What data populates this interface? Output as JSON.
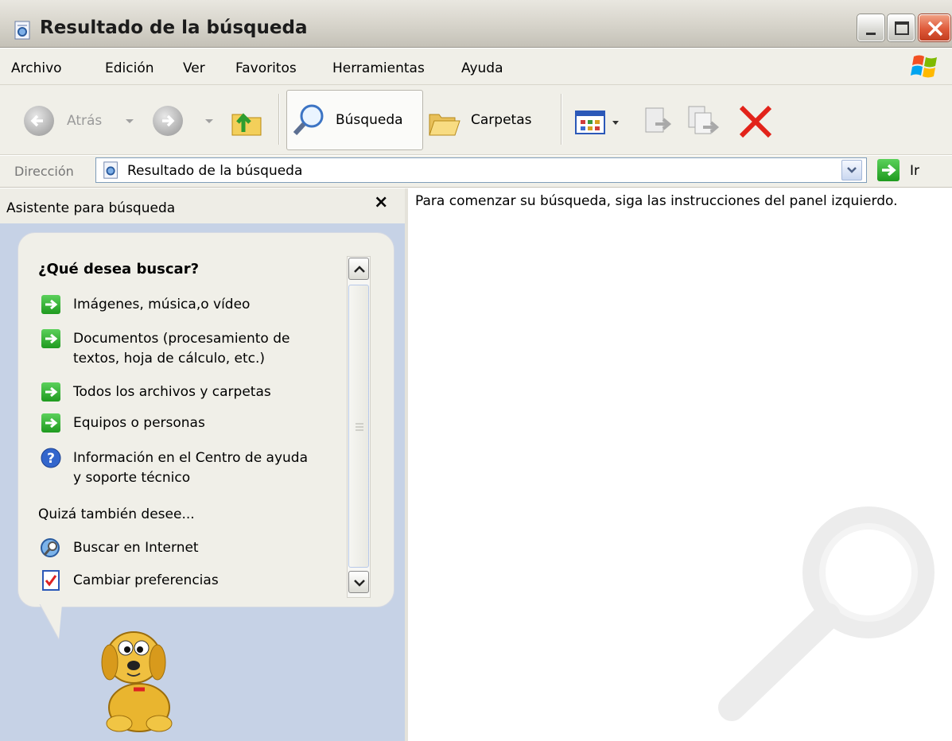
{
  "window": {
    "title": "Resultado de la búsqueda"
  },
  "menu": {
    "items": [
      "Archivo",
      "Edición",
      "Ver",
      "Favoritos",
      "Herramientas",
      "Ayuda"
    ]
  },
  "toolbar": {
    "back_label": "Atrás",
    "search_label": "Búsqueda",
    "folders_label": "Carpetas"
  },
  "address": {
    "label": "Dirección",
    "value": "Resultado de la búsqueda",
    "go_label": "Ir"
  },
  "search_panel": {
    "header": "Asistente para búsqueda",
    "question": "¿Qué desea buscar?",
    "options": [
      {
        "line1": "Imágenes, música,o vídeo",
        "line2": ""
      },
      {
        "line1": "Documentos (procesamiento de",
        "line2": "textos, hoja de cálculo, etc.)"
      },
      {
        "line1": "Todos los archivos y carpetas",
        "line2": ""
      },
      {
        "line1": "Equipos o personas",
        "line2": ""
      },
      {
        "line1": "Información en el Centro de ayuda",
        "line2": "y soporte técnico"
      }
    ],
    "also_label": "Quizá también desee...",
    "extra_options": [
      "Buscar en Internet",
      "Cambiar preferencias"
    ]
  },
  "results": {
    "instruction": "Para comenzar su búsqueda, siga las instrucciones del panel izquierdo."
  },
  "colors": {
    "panel_bg": "#c6d2e6",
    "arrow_green": "#1f9a1f",
    "close_red": "#df5a3a"
  },
  "icons": {
    "title": "search-results-icon",
    "back": "back-arrow-icon",
    "forward": "forward-arrow-icon",
    "up": "folder-up-icon",
    "search": "magnifier-icon",
    "folders": "folders-icon",
    "views": "views-icon",
    "move_to": "move-to-icon",
    "copy_to": "copy-to-icon",
    "delete": "delete-icon",
    "go": "go-arrow-icon",
    "help": "help-icon",
    "internet_search": "internet-search-icon",
    "preferences": "preferences-icon",
    "assistant": "dog-assistant-icon"
  }
}
